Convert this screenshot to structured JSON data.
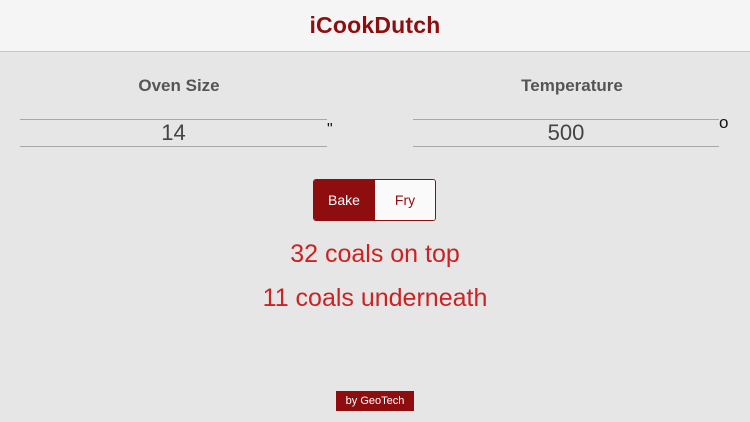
{
  "header": {
    "title": "iCookDutch"
  },
  "oven_size": {
    "label": "Oven Size",
    "value": "14",
    "unit": "\""
  },
  "temperature": {
    "label": "Temperature",
    "value": "500",
    "unit": "o"
  },
  "mode": {
    "options": [
      "Bake",
      "Fry"
    ],
    "selected": "Bake"
  },
  "results": {
    "coals_top": "32 coals on top",
    "coals_under": "11 coals underneath"
  },
  "footer": {
    "credit": "by GeoTech"
  },
  "colors": {
    "accent": "#8e0e10",
    "result_text": "#cc2222",
    "background": "#e6e6e6"
  }
}
